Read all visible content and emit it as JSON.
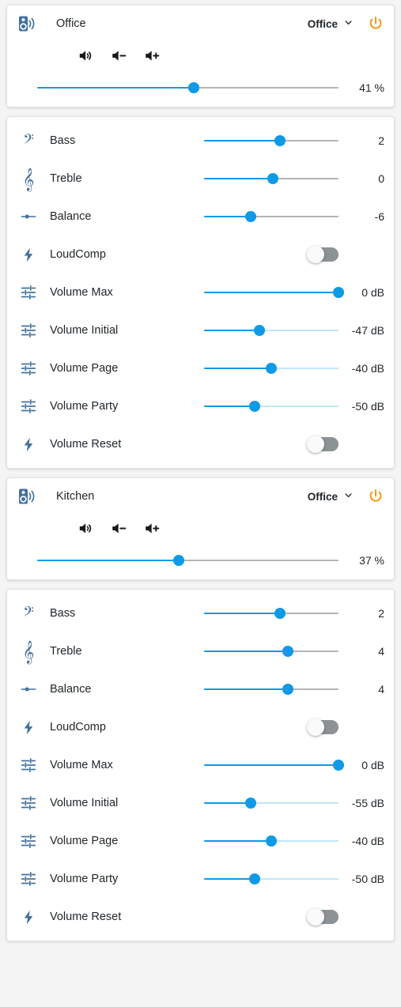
{
  "theme": {
    "page_bg": "#f4f4f4",
    "card_bg": "#ffffff",
    "accent_blue": "#0e9ae6",
    "icon_blue": "#41719c",
    "power_orange": "#f59000",
    "track_grey": "#b4b4b4",
    "track_light_blue": "#bde7fb",
    "text": "#21272b"
  },
  "zones": [
    {
      "header": {
        "speaker_icon": "speaker-icon",
        "name": "Office",
        "source_label": "Office",
        "source_caret_icon": "chevron-down-icon",
        "power_icon": "power-icon",
        "buttons": [
          {
            "icon": "volume-mute-icon",
            "name": "volume-toggle-button"
          },
          {
            "icon": "volume-down-icon",
            "name": "volume-down-button"
          },
          {
            "icon": "volume-up-icon",
            "name": "volume-up-button"
          }
        ],
        "volume_percent_label": "41 %",
        "volume_fill_ratio": 0.52
      },
      "settings": [
        {
          "icon": "bass-clef-icon",
          "label": "Bass",
          "type": "slider",
          "value": "2",
          "fill_ratio": 0.565,
          "track": "grey"
        },
        {
          "icon": "treble-clef-icon",
          "label": "Treble",
          "type": "slider",
          "value": "0",
          "fill_ratio": 0.51,
          "track": "grey"
        },
        {
          "icon": "balance-icon",
          "label": "Balance",
          "type": "slider",
          "value": "-6",
          "fill_ratio": 0.345,
          "track": "grey"
        },
        {
          "icon": "flash-icon",
          "label": "LoudComp",
          "type": "toggle",
          "value": "off"
        },
        {
          "icon": "tune-icon",
          "label": "Volume Max",
          "type": "slider",
          "value": "0 dB",
          "fill_ratio": 1.0,
          "track": "light"
        },
        {
          "icon": "tune-icon",
          "label": "Volume Initial",
          "type": "slider",
          "value": "-47 dB",
          "fill_ratio": 0.41,
          "track": "light"
        },
        {
          "icon": "tune-icon",
          "label": "Volume Page",
          "type": "slider",
          "value": "-40 dB",
          "fill_ratio": 0.5,
          "track": "light"
        },
        {
          "icon": "tune-icon",
          "label": "Volume Party",
          "type": "slider",
          "value": "-50 dB",
          "fill_ratio": 0.375,
          "track": "light"
        },
        {
          "icon": "flash-icon",
          "label": "Volume Reset",
          "type": "toggle",
          "value": "off"
        }
      ]
    },
    {
      "header": {
        "speaker_icon": "speaker-icon",
        "name": "Kitchen",
        "source_label": "Office",
        "source_caret_icon": "chevron-down-icon",
        "power_icon": "power-icon",
        "buttons": [
          {
            "icon": "volume-mute-icon",
            "name": "volume-toggle-button"
          },
          {
            "icon": "volume-down-icon",
            "name": "volume-down-button"
          },
          {
            "icon": "volume-up-icon",
            "name": "volume-up-button"
          }
        ],
        "volume_percent_label": "37 %",
        "volume_fill_ratio": 0.47
      },
      "settings": [
        {
          "icon": "bass-clef-icon",
          "label": "Bass",
          "type": "slider",
          "value": "2",
          "fill_ratio": 0.565,
          "track": "grey"
        },
        {
          "icon": "treble-clef-icon",
          "label": "Treble",
          "type": "slider",
          "value": "4",
          "fill_ratio": 0.625,
          "track": "grey"
        },
        {
          "icon": "balance-icon",
          "label": "Balance",
          "type": "slider",
          "value": "4",
          "fill_ratio": 0.625,
          "track": "grey"
        },
        {
          "icon": "flash-icon",
          "label": "LoudComp",
          "type": "toggle",
          "value": "off"
        },
        {
          "icon": "tune-icon",
          "label": "Volume Max",
          "type": "slider",
          "value": "0 dB",
          "fill_ratio": 1.0,
          "track": "light"
        },
        {
          "icon": "tune-icon",
          "label": "Volume Initial",
          "type": "slider",
          "value": "-55 dB",
          "fill_ratio": 0.345,
          "track": "light"
        },
        {
          "icon": "tune-icon",
          "label": "Volume Page",
          "type": "slider",
          "value": "-40 dB",
          "fill_ratio": 0.5,
          "track": "light"
        },
        {
          "icon": "tune-icon",
          "label": "Volume Party",
          "type": "slider",
          "value": "-50 dB",
          "fill_ratio": 0.375,
          "track": "light"
        },
        {
          "icon": "flash-icon",
          "label": "Volume Reset",
          "type": "toggle",
          "value": "off"
        }
      ]
    }
  ]
}
